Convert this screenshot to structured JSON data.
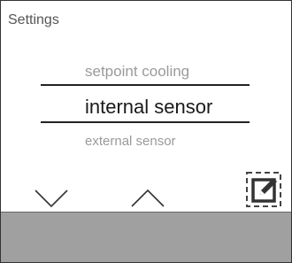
{
  "screen": {
    "title": "Settings"
  },
  "menu": {
    "previous_item": "setpoint cooling",
    "selected_item": "internal sensor",
    "next_item": "external sensor"
  },
  "controls": {
    "down_icon": "chevron-down-icon",
    "up_icon": "chevron-up-icon",
    "edit_icon": "edit-icon"
  },
  "colors": {
    "selected_text": "#1a1a1a",
    "unselected_text": "#9a9a9a",
    "bottom_bar": "#a0a0a0"
  }
}
